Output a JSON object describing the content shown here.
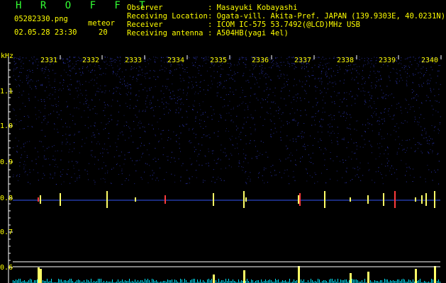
{
  "header": {
    "title": "H R O F F T",
    "filename": "05282330.png",
    "datetime": "02.05.28 23:30",
    "meteor_label": "meteor",
    "meteor_count": "20",
    "observer_label": "Observer",
    "observer_value": ": Masayuki Kobayashi",
    "location_label": "Receiving Location",
    "location_value": ": Ogata-vill. Akita-Pref. JAPAN (139.9303E, 40.0231N)",
    "receiver_label": "Receiver",
    "receiver_value": ": ICOM IC-575 53.7492(@LCD)MHz USB",
    "antenna_label": "Receiving antenna",
    "antenna_value": ": A504HB(yagi 4el)"
  },
  "axis": {
    "unit": "kHz",
    "y_ticks": [
      "1.1",
      "1.0",
      "0.9",
      "0.8",
      "0.7",
      "0.6"
    ],
    "time_ticks": [
      "2331",
      "2332",
      "2333",
      "2334",
      "2335",
      "2336",
      "2337",
      "2338",
      "2339",
      "2340"
    ]
  },
  "colors": {
    "background": "#000000",
    "label": "#ffff00",
    "title": "#33ff33",
    "noise": "#1f2a8c",
    "echo": "#ffff66",
    "echo_hot": "#ff3b3b",
    "histogram": "#00e5ff"
  }
}
